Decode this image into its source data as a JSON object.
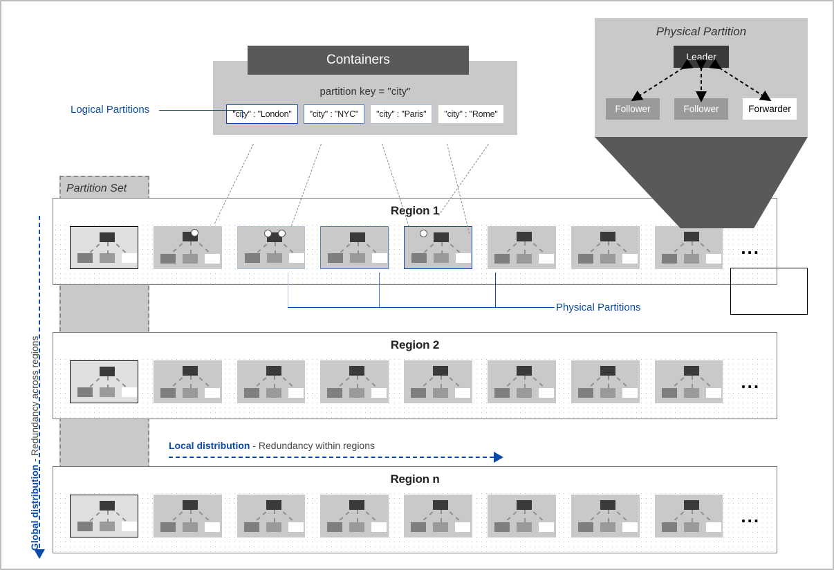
{
  "containers": {
    "title": "Containers",
    "partition_key": "partition key = \"city\"",
    "cities": [
      "\"city\" : \"London\"",
      "\"city\" : \"NYC\"",
      "\"city\" : \"Paris\"",
      "\"city\" : \"Rome\""
    ]
  },
  "labels": {
    "logical_partitions": "Logical Partitions",
    "physical_partitions": "Physical Partitions",
    "partition_set": "Partition Set",
    "global_distribution": "Global distribution",
    "global_distribution_sub": "  -  Redundancy across regions",
    "local_distribution": "Local distribution",
    "local_distribution_sub": "  -  Redundancy within regions",
    "ellipsis": "..."
  },
  "regions": [
    {
      "title": "Region 1"
    },
    {
      "title": "Region 2"
    },
    {
      "title": "Region n"
    }
  ],
  "magnifier": {
    "title": "Physical Partition",
    "leader": "Leader",
    "follower": "Follower",
    "forwarder": "Forwarder"
  }
}
